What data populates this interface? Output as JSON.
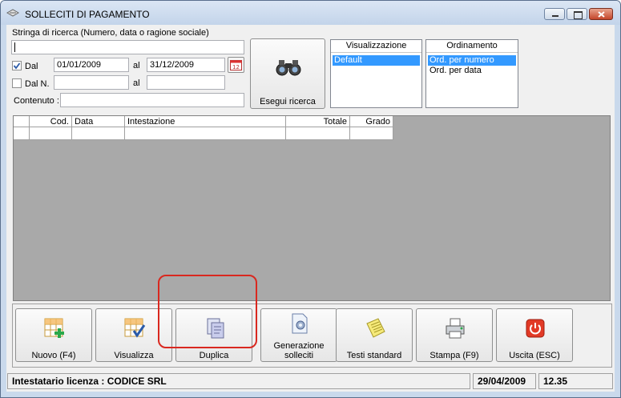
{
  "window": {
    "title": "SOLLECITI DI PAGAMENTO"
  },
  "search": {
    "string_label": "Stringa di ricerca (Numero, data o ragione sociale)",
    "string_value": "",
    "dal_label": "Dal",
    "dal_from": "01/01/2009",
    "al_label": "al",
    "dal_to": "31/12/2009",
    "daln_label": "Dal N.",
    "daln_from": "",
    "al2_label": "al",
    "daln_to": "",
    "contenuto_label": "Contenuto :",
    "contenuto_value": "",
    "run_label": "Esegui ricerca",
    "dal_checked": true,
    "daln_checked": false
  },
  "visualizzazione": {
    "header": "Visualizzazione",
    "items": [
      "Default"
    ],
    "selected": 0
  },
  "ordinamento": {
    "header": "Ordinamento",
    "items": [
      "Ord. per numero",
      "Ord. per data"
    ],
    "selected": 0
  },
  "grid": {
    "columns": [
      "Cod.",
      "Data",
      "Intestazione",
      "Totale",
      "Grado"
    ]
  },
  "toolbar": {
    "nuovo": "Nuovo (F4)",
    "visualizza": "Visualizza",
    "duplica": "Duplica",
    "generazione_1": "Generazione",
    "generazione_2": "solleciti",
    "testi": "Testi standard",
    "stampa": "Stampa (F9)",
    "uscita": "Uscita (ESC)"
  },
  "status": {
    "licenza": "Intestatario licenza : CODICE SRL",
    "date": "29/04/2009",
    "time": "12.35"
  },
  "colors": {
    "selection": "#3399ff",
    "highlight": "#d9281f",
    "grid_bg": "#a9a9a9"
  }
}
